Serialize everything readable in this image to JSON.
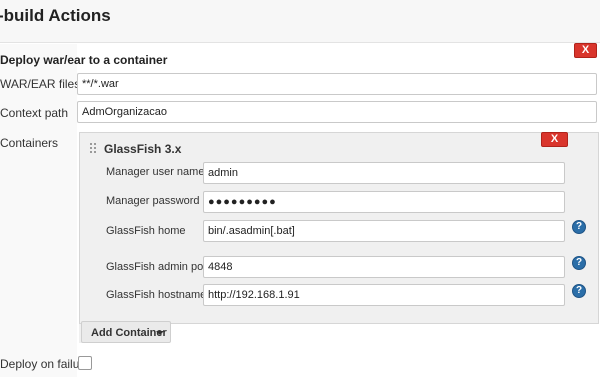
{
  "section": {
    "title": "-build Actions"
  },
  "deploy": {
    "heading": "Deploy war/ear to a container",
    "remove_label": "X",
    "war_ear_label": "WAR/EAR files",
    "war_ear_value": "**/*.war",
    "context_label": "Context path",
    "context_value": "AdmOrganizacao",
    "containers_label": "Containers",
    "deploy_on_failure_label": "Deploy on failure",
    "deploy_on_failure_checked": false
  },
  "container": {
    "title": "GlassFish 3.x",
    "remove_label": "X",
    "fields": {
      "manager_user_label": "Manager user name",
      "manager_user_value": "admin",
      "manager_password_label": "Manager password",
      "manager_password_value": "●●●●●●●●●",
      "home_label": "GlassFish home",
      "home_value": "bin/.asadmin[.bat]",
      "admin_port_label": "GlassFish admin port",
      "admin_port_value": "4848",
      "hostname_label": "GlassFish hostname",
      "hostname_value": "http://192.168.1.91"
    },
    "help_glyph": "?"
  },
  "add_container": {
    "label": "Add Container"
  },
  "colors": {
    "danger": "#d9352c",
    "help": "#2b6ea8"
  }
}
